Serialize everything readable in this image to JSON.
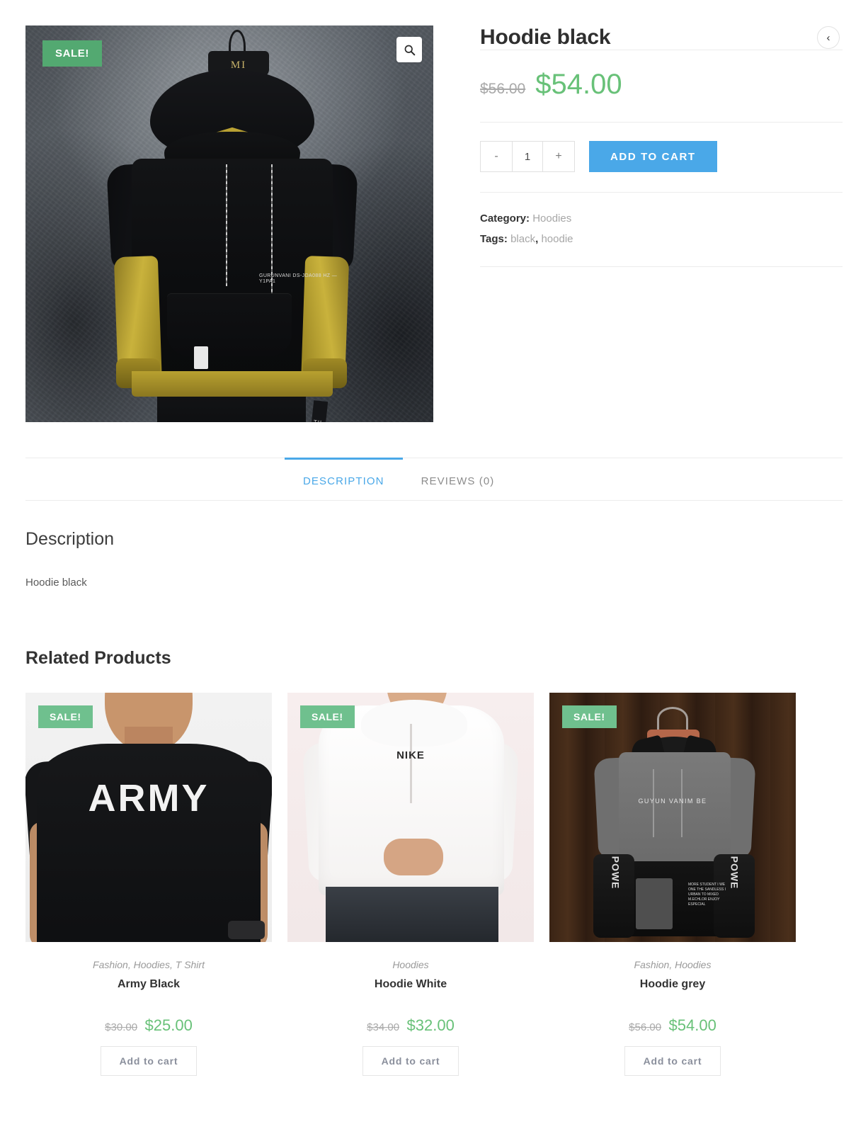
{
  "product": {
    "badge": "SALE!",
    "zoom_icon": "search-icon",
    "title": "Hoodie black",
    "prev_icon": "chevron-left-icon",
    "price_old": "$56.00",
    "price_new": "$54.00",
    "qty_decrement": "-",
    "qty_value": "1",
    "qty_increment": "+",
    "add_to_cart_label": "ADD TO CART",
    "category_label": "Category:",
    "category_value": "Hoodies",
    "tags_label": "Tags:",
    "tag_one": "black",
    "tag_sep": ",",
    "tag_two": "hoodie",
    "image_art": {
      "hanger_logo": "MI",
      "chest_print": "GURUNVANI DS-JDA088 HZ — Y1PA1",
      "side_strap": "TIL"
    }
  },
  "tabs": [
    {
      "label": "DESCRIPTION",
      "active": true
    },
    {
      "label": "REVIEWS (0)",
      "active": false
    }
  ],
  "description": {
    "heading": "Description",
    "body": "Hoodie black"
  },
  "related": {
    "heading": "Related Products",
    "add_to_cart_label": "Add to cart",
    "badge": "SALE!",
    "products": [
      {
        "categories": "Fashion, Hoodies, T Shirt",
        "name": "Army Black",
        "price_old": "$30.00",
        "price_new": "$25.00",
        "art_text": "ARMY"
      },
      {
        "categories": "Hoodies",
        "name": "Hoodie White",
        "price_old": "$34.00",
        "price_new": "$32.00",
        "art_text": "NIKE"
      },
      {
        "categories": "Fashion, Hoodies",
        "name": "Hoodie grey",
        "price_old": "$56.00",
        "price_new": "$54.00",
        "art_text": "GUYUN VANIM BE",
        "art_sleeve": "POWE",
        "art_fine": "MORE STUDENT I WE ONE THE SANDLESS I URBAN TO MIXED M.ECHLOR ENJOY ESPECIAL"
      }
    ]
  },
  "colors": {
    "accent_blue": "#4aa8e8",
    "sale_green": "#53a971",
    "price_green": "#68c178",
    "muted": "#a6a6a6"
  }
}
